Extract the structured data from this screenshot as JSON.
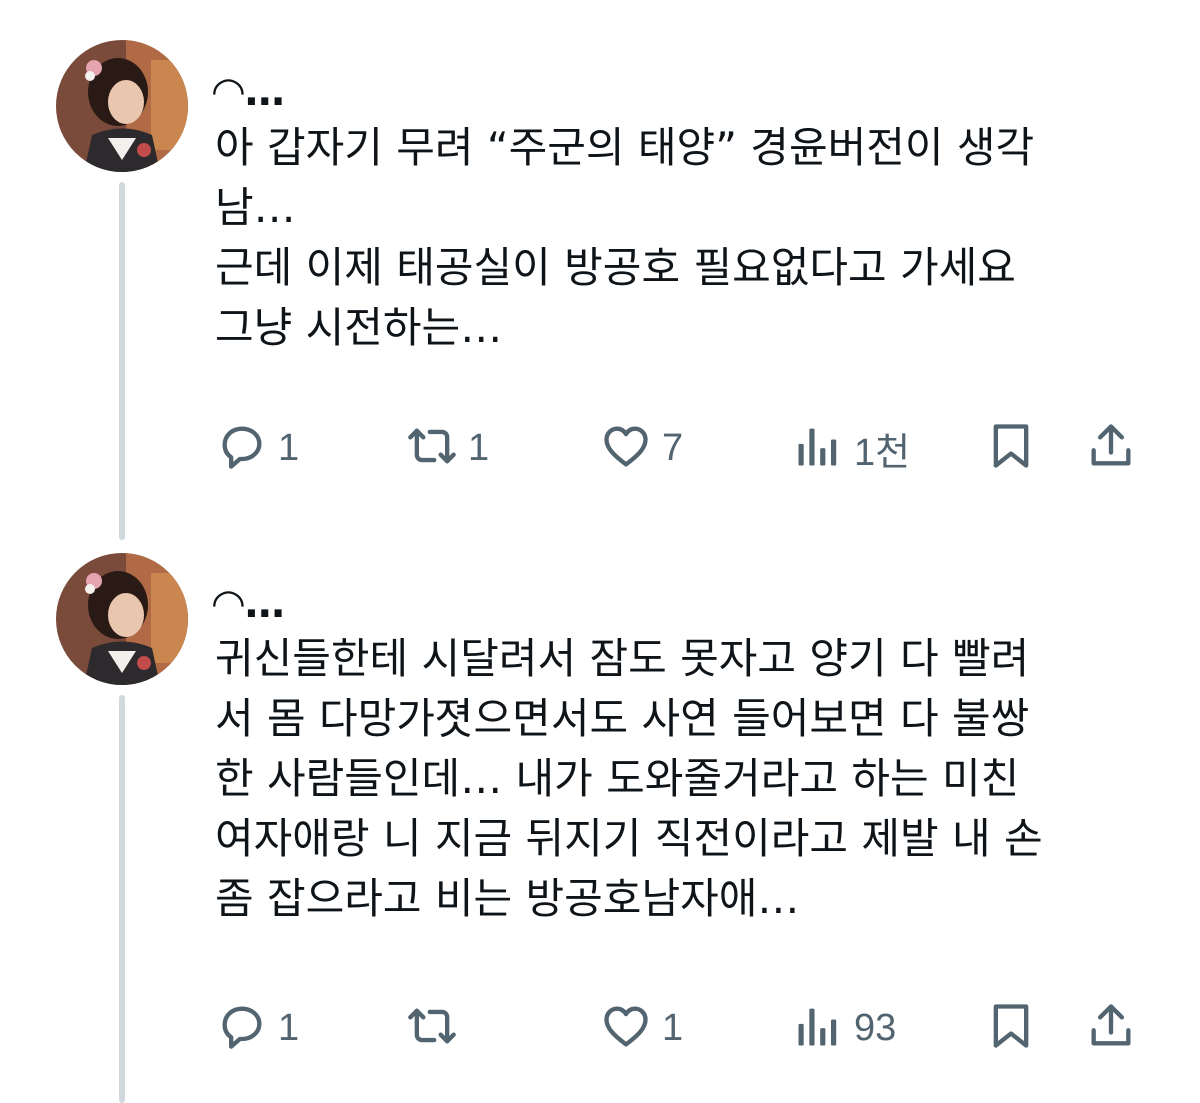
{
  "tweets": [
    {
      "author": "◠…",
      "text": "아 갑자기 무려 “주군의 태양” 경윤버전이 생각\n남…\n근데 이제 태공실이 방공호 필요없다고 가세요\n그냥 시전하는…",
      "actions": {
        "reply": {
          "icon": "reply-icon",
          "count": "1"
        },
        "retweet": {
          "icon": "retweet-icon",
          "count": "1"
        },
        "like": {
          "icon": "heart-icon",
          "count": "7"
        },
        "views": {
          "icon": "views-icon",
          "count": "1천"
        },
        "bookmark": {
          "icon": "bookmark-icon"
        },
        "share": {
          "icon": "share-icon"
        }
      }
    },
    {
      "author": "◠…",
      "text": "귀신들한테 시달려서 잠도 못자고 양기 다 빨려\n서 몸 다망가졋으면서도 사연 들어보면 다 불쌍\n한 사람들인데… 내가 도와줄거라고 하는 미친\n여자애랑 니 지금 뒤지기 직전이라고 제발 내 손\n좀 잡으라고 비는 방공호남자애…",
      "actions": {
        "reply": {
          "icon": "reply-icon",
          "count": "1"
        },
        "retweet": {
          "icon": "retweet-icon",
          "count": ""
        },
        "like": {
          "icon": "heart-icon",
          "count": "1"
        },
        "views": {
          "icon": "views-icon",
          "count": "93"
        },
        "bookmark": {
          "icon": "bookmark-icon"
        },
        "share": {
          "icon": "share-icon"
        }
      }
    }
  ],
  "colors": {
    "text": "#0f1419",
    "muted": "#536471",
    "thread_line": "#cfd9de"
  }
}
